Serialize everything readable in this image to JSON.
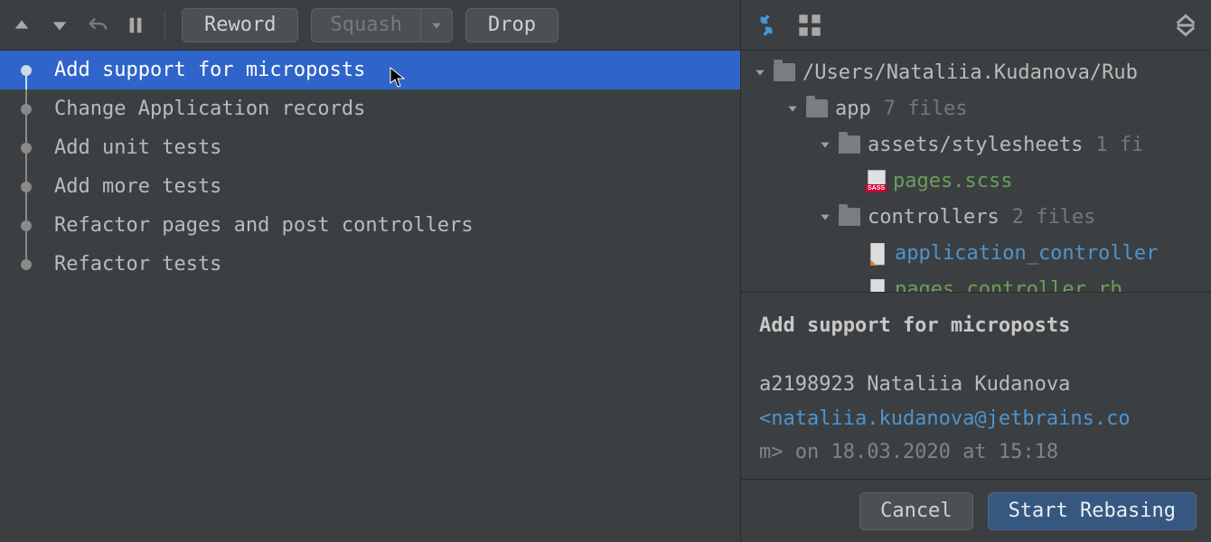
{
  "toolbar": {
    "reword_label": "Reword",
    "squash_label": "Squash",
    "drop_label": "Drop"
  },
  "commits": [
    {
      "message": "Add support for microposts",
      "selected": true
    },
    {
      "message": "Change Application records",
      "selected": false
    },
    {
      "message": "Add unit tests",
      "selected": false
    },
    {
      "message": "Add more tests",
      "selected": false
    },
    {
      "message": "Refactor pages and post controllers",
      "selected": false
    },
    {
      "message": "Refactor tests",
      "selected": false
    }
  ],
  "tree": {
    "root": {
      "path": "/Users/Nataliia.Kudanova/Rub"
    },
    "app": {
      "name": "app",
      "count": "7 files"
    },
    "assets": {
      "name": "assets/stylesheets",
      "count": "1 fi"
    },
    "pages_scss": {
      "name": "pages.scss"
    },
    "controllers": {
      "name": "controllers",
      "count": "2 files"
    },
    "app_controller": {
      "name": "application_controller"
    },
    "pages_controller": {
      "name": "pages_controller.rb"
    }
  },
  "details": {
    "title": "Add support for microposts",
    "hash": "a2198923",
    "author": "Nataliia Kudanova",
    "email": "<nataliia.kudanova@jetbrains.co",
    "date_partial": "m> on 18.03.2020 at 15:18"
  },
  "footer": {
    "cancel_label": "Cancel",
    "primary_label": "Start Rebasing"
  }
}
